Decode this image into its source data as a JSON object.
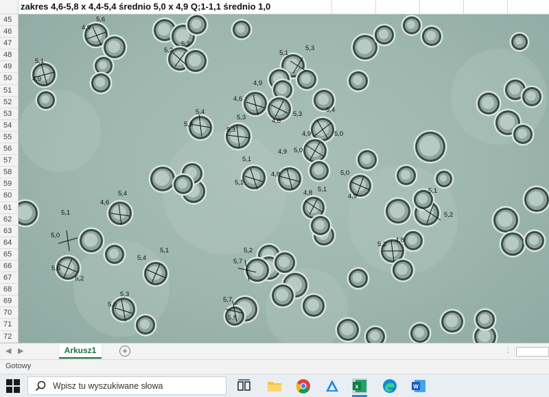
{
  "sheet": {
    "title_cell": "zakres 4,6-5,8 x 4,4-5,4 średnio 5,0 x 4,9  Q;1-1,1 średnio 1,0",
    "row_numbers": [
      "45",
      "46",
      "47",
      "48",
      "49",
      "50",
      "51",
      "52",
      "53",
      "54",
      "55",
      "56",
      "57",
      "58",
      "59",
      "60",
      "61",
      "62",
      "63",
      "64",
      "65",
      "66",
      "67",
      "68",
      "69",
      "70",
      "71",
      "72"
    ],
    "tab_name": "Arkusz1",
    "add_sheet_symbol": "+",
    "status": "Gotowy"
  },
  "measurements": [
    {
      "label": "4,9"
    },
    {
      "label": "5,6"
    },
    {
      "label": "5,2"
    },
    {
      "label": "5,2"
    },
    {
      "label": "5,1"
    },
    {
      "label": "4,9"
    },
    {
      "label": "5,1"
    },
    {
      "label": "5,3"
    },
    {
      "label": "4,9"
    },
    {
      "label": "4,6"
    },
    {
      "label": "4,8"
    },
    {
      "label": "5,3"
    },
    {
      "label": "5,4"
    },
    {
      "label": "5,2"
    },
    {
      "label": "5,3"
    },
    {
      "label": "5,3"
    },
    {
      "label": "5,4"
    },
    {
      "label": "5,0"
    },
    {
      "label": "5,0"
    },
    {
      "label": "4,9"
    },
    {
      "label": "5,1"
    },
    {
      "label": "5,1"
    },
    {
      "label": "4,9"
    },
    {
      "label": "4,8"
    },
    {
      "label": "5,0"
    },
    {
      "label": "4,9"
    },
    {
      "label": "4,8"
    },
    {
      "label": "5,1"
    },
    {
      "label": "4,6"
    },
    {
      "label": "5,4"
    },
    {
      "label": "5,1"
    },
    {
      "label": "5,2"
    },
    {
      "label": "5,1"
    },
    {
      "label": "5,0"
    },
    {
      "label": "5,6"
    },
    {
      "label": "5,2"
    },
    {
      "label": "4,8"
    },
    {
      "label": "5,2"
    },
    {
      "label": "5,4"
    },
    {
      "label": "5,1"
    },
    {
      "label": "5,2"
    },
    {
      "label": "5,7"
    },
    {
      "label": "5,3"
    },
    {
      "label": "5,0"
    },
    {
      "label": "5,7"
    },
    {
      "label": "5,8"
    }
  ],
  "taskbar": {
    "search_placeholder": "Wpisz tu wyszukiwane słowa",
    "apps": [
      "task-view-icon",
      "file-explorer-icon",
      "chrome-icon",
      "azure-data-studio-icon",
      "excel-icon",
      "edge-icon",
      "word-icon"
    ]
  }
}
